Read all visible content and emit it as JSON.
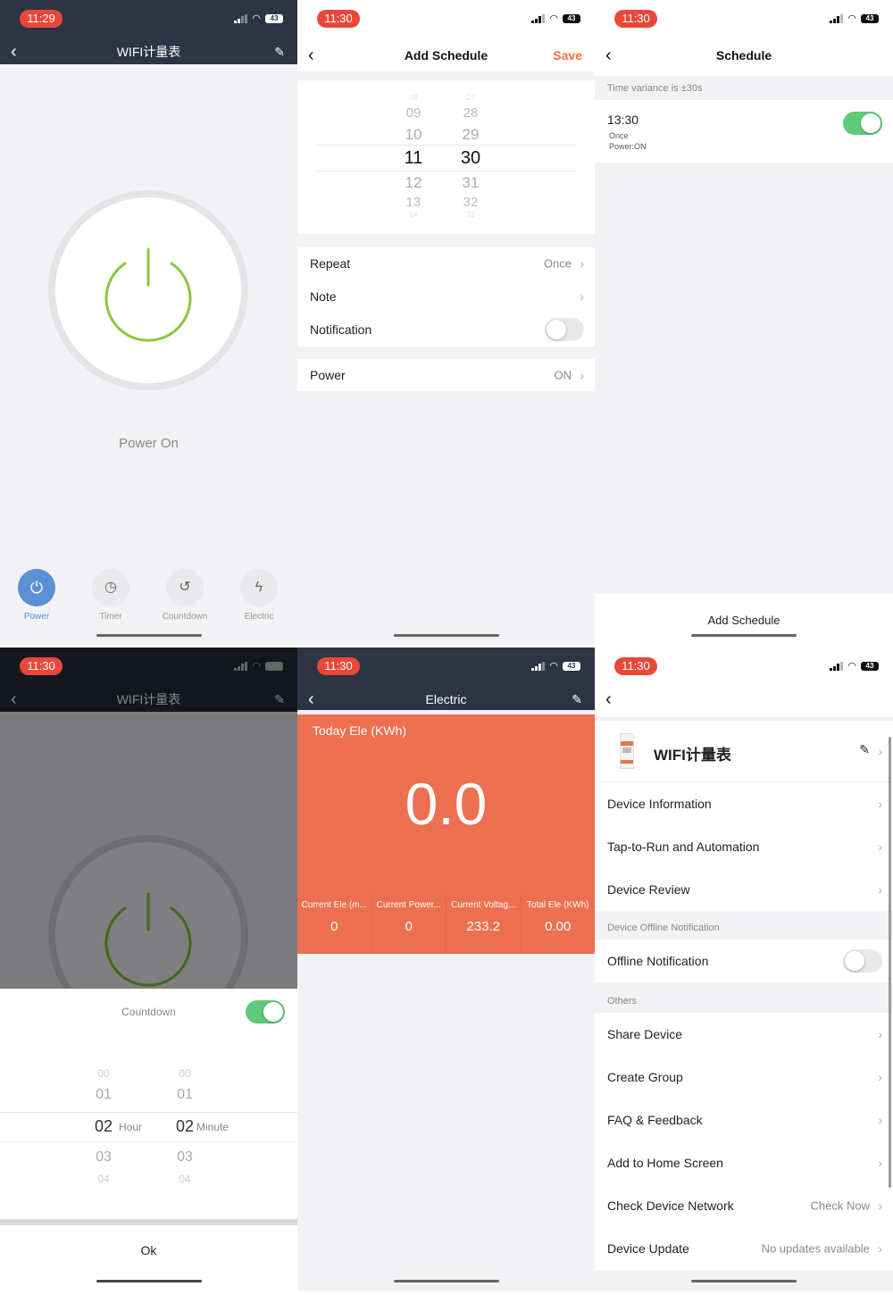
{
  "status": {
    "time1": "11:29",
    "time2": "11:30",
    "battery": "43"
  },
  "colors": {
    "green": "#8cc63f",
    "accent": "#f0703e",
    "orange_panel": "#ec6f4f",
    "toggle_on": "#5fcb78",
    "power_blue": "#5b8fd6",
    "dark": "#2e3445"
  },
  "main": {
    "title": "WIFI计量表",
    "power_state": "Power On",
    "tabs": [
      {
        "label": "Power",
        "icon": "power-icon"
      },
      {
        "label": "Timer",
        "icon": "timer-icon"
      },
      {
        "label": "Countdown",
        "icon": "countdown-icon"
      },
      {
        "label": "Electric",
        "icon": "lightning-icon"
      }
    ]
  },
  "add_schedule": {
    "title": "Add Schedule",
    "save": "Save",
    "hours": [
      "08",
      "09",
      "10",
      "11",
      "12",
      "13",
      "14"
    ],
    "minutes": [
      "27",
      "28",
      "29",
      "30",
      "31",
      "32",
      "33"
    ],
    "repeat_label": "Repeat",
    "repeat_value": "Once",
    "note_label": "Note",
    "notification_label": "Notification",
    "notification_on": false,
    "power_label": "Power",
    "power_value": "ON"
  },
  "schedule": {
    "title": "Schedule",
    "variance": "Time variance is  ±30s",
    "item": {
      "time": "13:30",
      "repeat": "Once",
      "action": "Power:ON",
      "enabled": true
    },
    "add": "Add Schedule"
  },
  "countdown": {
    "title": "WIFI计量表",
    "label": "Countdown",
    "enabled": true,
    "hours": [
      "00",
      "01",
      "02",
      "03",
      "04"
    ],
    "minutes": [
      "00",
      "01",
      "02",
      "03",
      "04"
    ],
    "hour_unit": "Hour",
    "minute_unit": "Minute",
    "ok": "Ok"
  },
  "electric": {
    "title": "Electric",
    "today_label": "Today Ele (KWh)",
    "today_value": "0.0",
    "stats": [
      {
        "label": "Current Ele (m...",
        "value": "0"
      },
      {
        "label": "Current Power...",
        "value": "0"
      },
      {
        "label": "Current Voltag...",
        "value": "233.2"
      },
      {
        "label": "Total Ele (KWh)",
        "value": "0.00"
      }
    ]
  },
  "settings": {
    "device_name": "WIFI计量表",
    "items1": [
      "Device Information",
      "Tap-to-Run and Automation",
      "Device Review"
    ],
    "offline_section": "Device Offline Notification",
    "offline_label": "Offline Notification",
    "offline_on": false,
    "others_section": "Others",
    "items2": [
      "Share Device",
      "Create Group",
      "FAQ & Feedback",
      "Add to Home Screen"
    ],
    "network_label": "Check Device Network",
    "network_value": "Check Now",
    "update_label": "Device Update",
    "update_value": "No updates available"
  }
}
